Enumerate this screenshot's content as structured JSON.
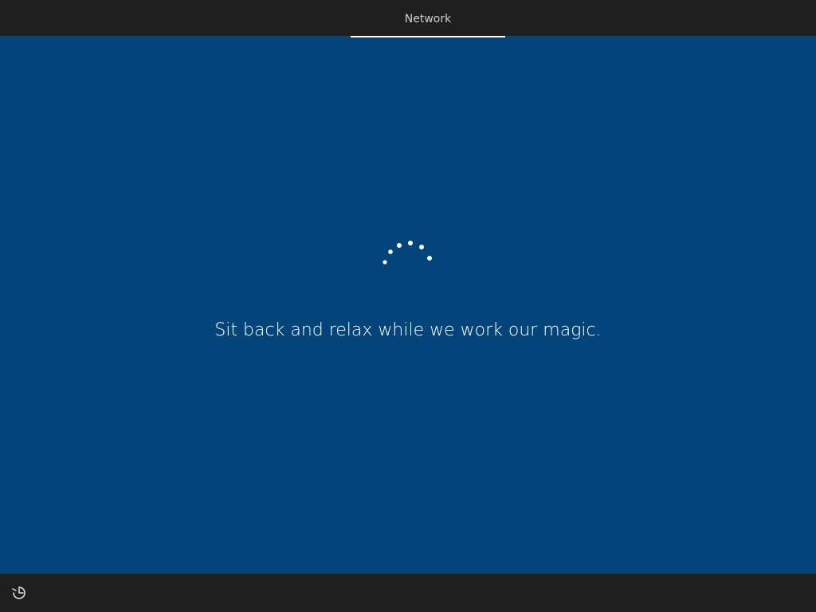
{
  "header": {
    "tabs": [
      {
        "label": "Network",
        "active": true
      }
    ]
  },
  "main": {
    "message": "Sit back and relax while we work our magic."
  },
  "footer": {
    "accessibility_icon": "ease-of-access-icon"
  },
  "colors": {
    "background": "#03457a",
    "bar": "#1f1f1f",
    "text": "#ffffff",
    "tab_text": "#cfcfcf"
  }
}
